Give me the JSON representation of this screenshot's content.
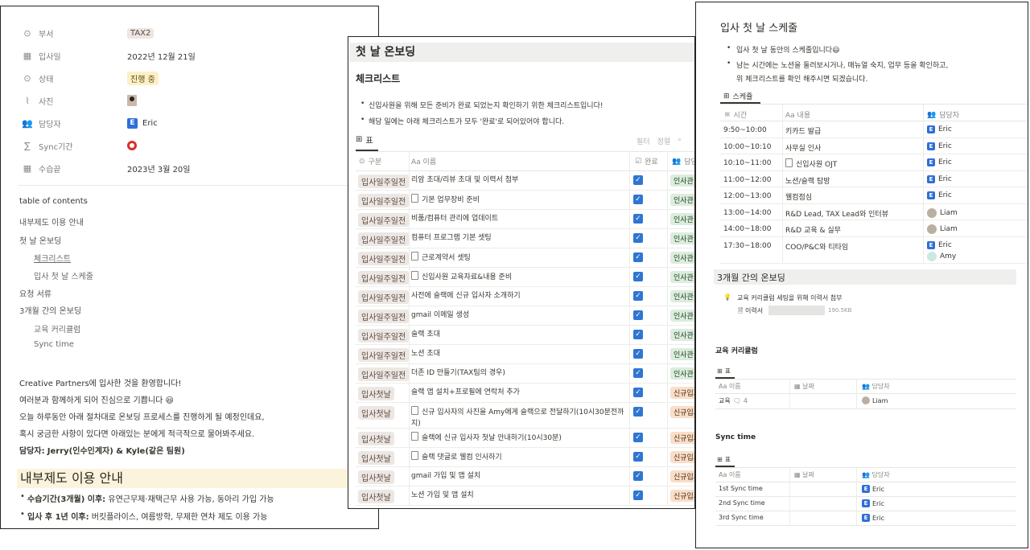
{
  "page1": {
    "properties": [
      {
        "icon": "chevron-circle-icon",
        "name": "부서",
        "value": "TAX2"
      },
      {
        "icon": "calendar-icon",
        "name": "입사일",
        "value": "2022년 12월 21일"
      },
      {
        "icon": "chevron-circle-icon",
        "name": "상태",
        "value": "진행 중"
      },
      {
        "icon": "paperclip-icon",
        "name": "사진",
        "value": ""
      },
      {
        "icon": "people-icon",
        "name": "담당자",
        "value": "Eric"
      },
      {
        "icon": "sigma-icon",
        "name": "Sync기간",
        "value": ""
      },
      {
        "icon": "calendar-icon",
        "name": "수습끝",
        "value": "2023년 3월 20일"
      }
    ],
    "toc_title": "table of contents",
    "toc": [
      "내부제도 이용 안내",
      "첫 날 온보딩",
      "체크리스트",
      "입사 첫 날 스케줄",
      "요청 서류",
      "3개월 간의 온보딩",
      "교육 커리큘럼",
      "Sync time"
    ],
    "intro": [
      "Creative Partners에 입사한 것을 환영합니다!",
      "여러분과 함께하게 되어 진심으로 기쁩니다",
      "오늘 하루동안 아래 절차대로 온보딩 프로세스를 진행하게 될 예정인데요,",
      "혹시 궁금한 사항이 있다면 아래있는 분에게 적극적으로 물어봐주세요."
    ],
    "manager_label": "담당자:",
    "manager_value": "Jerry(인수인계자) & Kyle(같은 팀원)",
    "section_heading": "내부제도 이용 안내",
    "bullets": [
      {
        "bold": "수습기간(3개월) 이후:",
        "text": " 유연근무제·재택근무 사용 가능, 동아리 가입 가능"
      },
      {
        "bold": "입사 후 1년 이후:",
        "text": " 버킷플라이스, 여름방학, 무제한 연차 제도 이용 가능"
      }
    ]
  },
  "page2": {
    "title": "첫 날 온보딩",
    "heading": "체크리스트",
    "bullets": [
      "신입사원을 위해 모든 준비가 완료 되었는지 확인하기 위한 체크리스트입니다!",
      "해당 일에는 아래 체크리스트가 모두 '완료'로 되어있어야 합니다."
    ],
    "view_tab": "표",
    "view_actions": [
      "필터",
      "정렬"
    ],
    "columns": [
      "구분",
      "Aa 이름",
      "완료",
      "담당"
    ],
    "rows": [
      {
        "group": "입사일주일전",
        "name": "리암 초대/리뷰 초대 및 이력서 첨부",
        "doc": false,
        "owner": "인사관"
      },
      {
        "group": "입사일주일전",
        "name": "기본 업무장비 준비",
        "doc": true,
        "owner": "인사관"
      },
      {
        "group": "입사일주일전",
        "name": "비품/컴퓨터 관리에 업데이트",
        "doc": false,
        "owner": "인사관"
      },
      {
        "group": "입사일주일전",
        "name": "컴퓨터 프로그램 기본 셋팅",
        "doc": false,
        "owner": "인사관"
      },
      {
        "group": "입사일주일전",
        "name": "근로계약서 셋팅",
        "doc": true,
        "owner": "인사관"
      },
      {
        "group": "입사일주일전",
        "name": "신입사원 교육자료&내용 준비",
        "doc": true,
        "owner": "인사관"
      },
      {
        "group": "입사일주일전",
        "name": "사전에 슬랙에 신규 입사자 소개하기",
        "doc": false,
        "owner": "인사관"
      },
      {
        "group": "입사일주일전",
        "name": "gmail 이메일 생성",
        "doc": false,
        "owner": "인사관"
      },
      {
        "group": "입사일주일전",
        "name": "슬랙 초대",
        "doc": false,
        "owner": "인사관"
      },
      {
        "group": "입사일주일전",
        "name": "노션 초대",
        "doc": false,
        "owner": "인사관"
      },
      {
        "group": "입사일주일전",
        "name": "더존 ID 만들기(TAX팀의 경우)",
        "doc": false,
        "owner": "인사관"
      },
      {
        "group": "입사첫날",
        "name": "슬랙 앱 설치+프로필에 연락처 추가",
        "doc": false,
        "owner": "신규입사"
      },
      {
        "group": "입사첫날",
        "name": "신규 입사자의 사진을 Amy에게 슬랙으로 전달하기(10시30분전까지)",
        "doc": true,
        "owner": "신규입사"
      },
      {
        "group": "입사첫날",
        "name": "슬랙에 신규 입사자 첫날 안내하기(10시30분)",
        "doc": true,
        "owner": "신규입사"
      },
      {
        "group": "입사첫날",
        "name": "슬랙 댓글로 웰컴 인사하기",
        "doc": true,
        "owner": "신규입사"
      },
      {
        "group": "입사첫날",
        "name": "gmail 가입 및 앱 설치",
        "doc": false,
        "owner": "신규입사"
      },
      {
        "group": "입사첫날",
        "name": "노션 가입 및 앱 설치",
        "doc": false,
        "owner": "신규입사"
      }
    ]
  },
  "page3": {
    "title": "입사 첫 날 스케줄",
    "bullets": [
      "입사 첫 날 동안의 스케줄입니다",
      "남는 시간에는 노션을 둘러보시거나, 매뉴얼 숙지, 업무 등을 확인하고,",
      "위 체크리스트를 확인 해주시면 되겠습니다."
    ],
    "view_tab": "스케쥴",
    "columns": [
      "시간",
      "Aa 내용",
      "담당자"
    ],
    "schedule": [
      {
        "time": "9:50~10:00",
        "content": "키카드 발급",
        "doc": false,
        "owners": [
          "Eric"
        ]
      },
      {
        "time": "10:00~10:10",
        "content": "사무실 인사",
        "doc": false,
        "owners": [
          "Eric"
        ]
      },
      {
        "time": "10:10~11:00",
        "content": "신입사원 OJT",
        "doc": true,
        "owners": [
          "Eric"
        ]
      },
      {
        "time": "11:00~12:00",
        "content": "노션/슬랙 탐방",
        "doc": false,
        "owners": [
          "Eric"
        ]
      },
      {
        "time": "12:00~13:00",
        "content": "웰컴점심",
        "doc": false,
        "owners": [
          "Eric"
        ]
      },
      {
        "time": "13:00~14:00",
        "content": "R&D Lead, TAX Lead와 인터뷰",
        "doc": false,
        "owners": [
          "Liam"
        ]
      },
      {
        "time": "14:00~18:00",
        "content": "R&D 교육 & 실무",
        "doc": false,
        "owners": [
          "Liam"
        ]
      },
      {
        "time": "17:30~18:00",
        "content": "COO/P&C와 티타임",
        "doc": false,
        "owners": [
          "Eric",
          "Amy"
        ]
      }
    ],
    "onboarding_heading": "3개월 간의 온보딩",
    "callout_text": "교육 커리큘럼 세팅을 위해 이력서 첨부",
    "file_name": "이력서",
    "file_size": "190.5KB",
    "curriculum": {
      "heading": "교육 커리큘럼",
      "tab": "표",
      "columns": [
        "Aa 이름",
        "날짜",
        "담당자"
      ],
      "rows": [
        {
          "name": "교육",
          "comments": "4",
          "owner": "Liam"
        }
      ]
    },
    "sync": {
      "heading": "Sync time",
      "tab": "표",
      "columns": [
        "Aa 이름",
        "날짜",
        "담당자"
      ],
      "rows": [
        {
          "name": "1st Sync time",
          "owner": "Eric"
        },
        {
          "name": "2nd Sync time",
          "owner": "Eric"
        },
        {
          "name": "3rd Sync time",
          "owner": "Eric"
        }
      ]
    }
  },
  "colors": {
    "accent_blue": "#2f76d2",
    "tag_green": "#dbeddb",
    "tag_orange": "#fadec9",
    "heading_highlight": "#fbf3db"
  }
}
